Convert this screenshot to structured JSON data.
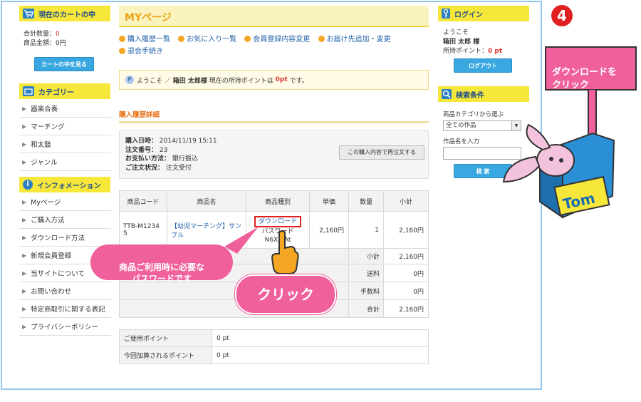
{
  "cart": {
    "title": "現在のカートの中",
    "qty_label": "合計数量：",
    "qty_value": "0",
    "price_label": "商品金額：",
    "price_value": "0円",
    "view_button": "カートの中を見る"
  },
  "category": {
    "title": "カテゴリー",
    "items": [
      "器楽合奏",
      "マーチング",
      "和太鼓",
      "ジャンル"
    ]
  },
  "info": {
    "title": "インフォメーション",
    "items": [
      "Myページ",
      "ご購入方法",
      "ダウンロード方法",
      "新規会員登録",
      "当サイトについて",
      "お問い合わせ",
      "特定商取引に関する表記",
      "プライバシーポリシー"
    ]
  },
  "main": {
    "title": "MYページ",
    "links": [
      "購入履歴一覧",
      "お気に入り一覧",
      "会員登録内容変更",
      "お届け先追加・変更",
      "退会手続き"
    ],
    "welcome_prefix": "ようこそ ／",
    "welcome_name": "箱田 太郎様",
    "welcome_mid": "現在の所持ポイントは",
    "welcome_points": "0pt",
    "welcome_suffix": "です。",
    "history_title": "購入履歴詳細",
    "order": {
      "date_label": "購入日時：",
      "date_value": "2014/11/19 15:11",
      "no_label": "注文番号：",
      "no_value": "23",
      "pay_label": "お支払い方法：",
      "pay_value": "銀行振込",
      "status_label": "ご注文状況：",
      "status_value": "注文受付",
      "reorder_button": "この購入内容で再注文する"
    },
    "table": {
      "headers": [
        "商品コード",
        "商品名",
        "商品種別",
        "単価",
        "数量",
        "小計"
      ],
      "row": {
        "code": "TTB-M12345",
        "name": "【幼児マーチング】サンプル",
        "download": "ダウンロード",
        "password_label": "パスワード",
        "password_value": "N6X...At",
        "price": "2,160円",
        "qty": "1",
        "subtotal": "2,160円"
      },
      "summary": [
        {
          "label": "小計",
          "value": "2,160円"
        },
        {
          "label": "送料",
          "value": "0円"
        },
        {
          "label": "手数料",
          "value": "0円"
        },
        {
          "label": "合計",
          "value": "2,160円"
        }
      ]
    },
    "points": [
      {
        "label": "ご使用ポイント",
        "value": "0 pt"
      },
      {
        "label": "今回加算されるポイント",
        "value": "0 pt"
      }
    ]
  },
  "login": {
    "title": "ログイン",
    "welcome": "ようこそ",
    "name": "箱田 太郎 様",
    "points_label": "所持ポイント：",
    "points_value": "0 pt",
    "logout_button": "ログアウト"
  },
  "search": {
    "title": "検索条件",
    "category_label": "商品カテゴリから選ぶ",
    "category_value": "全ての作品",
    "name_label": "作品名を入力",
    "name_value": "",
    "button": "検 索"
  },
  "annotations": {
    "step_number": "4",
    "download_hint": "ダウンロードを\nクリック",
    "password_hint": "商品ご利用時に必要な\nパスワードです",
    "click_hint": "クリック",
    "mascot_text": "Tom"
  }
}
